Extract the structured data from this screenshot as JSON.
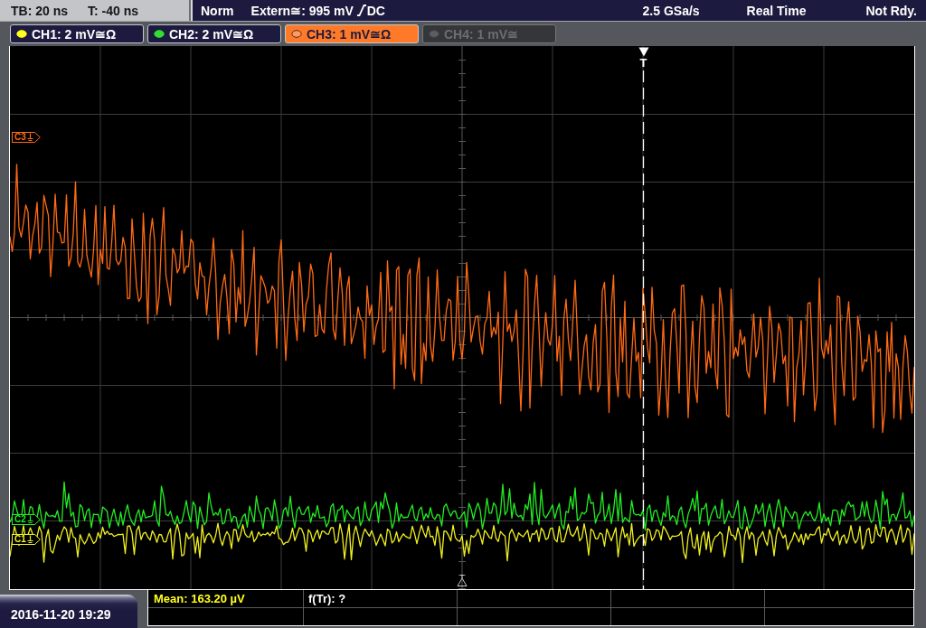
{
  "status_bar": {
    "timebase": "TB: 20 ns",
    "trigger_time": "T: -40 ns",
    "trigger_mode": "Norm",
    "trigger_source": "Extern≅: 995 mV",
    "trigger_coupling": "DC",
    "sample_rate": "2.5 GSa/s",
    "acquisition_mode": "Real Time",
    "acquisition_state": "Not Rdy."
  },
  "channels": [
    {
      "label": "CH1: 2 mV≅Ω",
      "color": "#ffff20",
      "selected": false,
      "enabled": true
    },
    {
      "label": "CH2: 2 mV≅Ω",
      "color": "#33dd33",
      "selected": false,
      "enabled": true
    },
    {
      "label": "CH3: 1 mV≅Ω",
      "color": "#ff9a66",
      "selected": true,
      "enabled": true
    },
    {
      "label": "CH4: 1 mV≅",
      "color": "#5c5e62",
      "selected": false,
      "enabled": false
    }
  ],
  "display": {
    "trigger_marker": "T",
    "traces": [
      {
        "label": "C3",
        "kind": "decaying",
        "color": "#ff6a14"
      },
      {
        "label": "C2",
        "kind": "noise",
        "color": "#22ee22"
      },
      {
        "label": "C1",
        "kind": "noise",
        "color": "#f0f020"
      }
    ]
  },
  "datetime": "2016-11-20 19:29",
  "measurements": [
    {
      "text": "Mean: 163.20 µV",
      "color": "#ffff20"
    },
    {
      "text": "f(Tr): ?",
      "color": "#ffffff"
    }
  ]
}
